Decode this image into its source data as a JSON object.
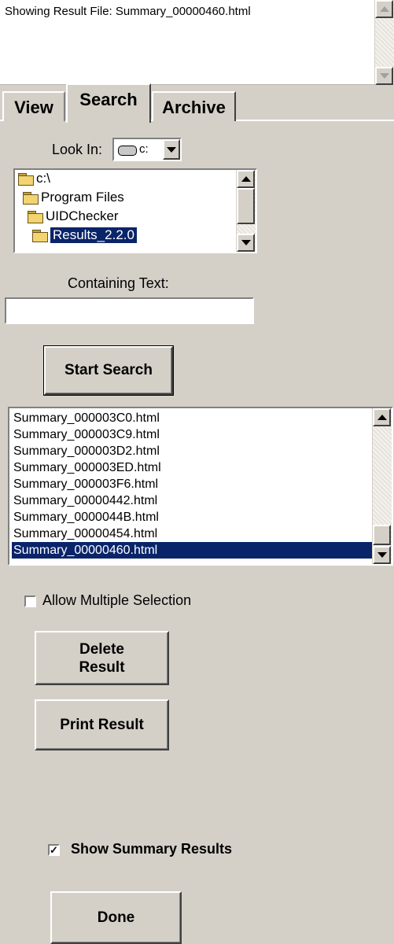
{
  "status_text": "Showing Result File: Summary_00000460.html",
  "tabs": [
    {
      "label": "View"
    },
    {
      "label": "Search"
    },
    {
      "label": "Archive"
    }
  ],
  "look_in": {
    "label": "Look In:",
    "drive": "c:"
  },
  "folders": [
    {
      "label": "c:\\"
    },
    {
      "label": "Program Files"
    },
    {
      "label": "UIDChecker"
    },
    {
      "label": "Results_2.2.0"
    }
  ],
  "containing_text": {
    "label": "Containing Text:",
    "value": ""
  },
  "start_search_label": "Start Search",
  "results": [
    "Summary_000003C0.html",
    "Summary_000003C9.html",
    "Summary_000003D2.html",
    "Summary_000003ED.html",
    "Summary_000003F6.html",
    "Summary_00000442.html",
    "Summary_0000044B.html",
    "Summary_00000454.html",
    "Summary_00000460.html"
  ],
  "allow_multiple": {
    "label": "Allow Multiple Selection",
    "checked": false
  },
  "delete_result_label": "Delete\nResult",
  "print_result_label": "Print Result",
  "show_summary": {
    "label": "Show Summary Results",
    "checked": true
  },
  "done_label": "Done",
  "colors": {
    "selection": "#0a246a",
    "face": "#d4d0c8"
  }
}
